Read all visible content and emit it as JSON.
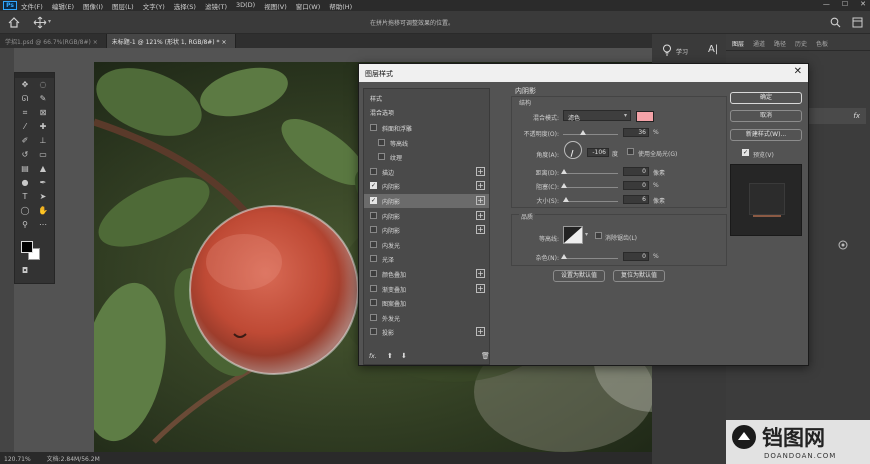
{
  "app": {
    "logo": "Ps"
  },
  "menu": [
    "文件(F)",
    "编辑(E)",
    "图像(I)",
    "图层(L)",
    "文字(Y)",
    "选择(S)",
    "滤镜(T)",
    "3D(D)",
    "视图(V)",
    "窗口(W)",
    "帮助(H)"
  ],
  "window_controls": {
    "min": "—",
    "max": "☐",
    "close": "✕"
  },
  "options_bar": {
    "hint": "在拼片拖移可调整效果的位置。"
  },
  "doc_tabs": [
    {
      "label": "学招1.psd @ 66.7%(RGB/8#) ×",
      "active": false
    },
    {
      "label": "未标题-1 @ 121% (形状 1, RGB/8#) * ×",
      "active": true
    }
  ],
  "status": {
    "zoom": "120.71%",
    "doc": "文档:2.84M/56.2M"
  },
  "right_panels": {
    "learn_label": "学习",
    "tabs": [
      "图层",
      "通道",
      "路径",
      "历史",
      "色板"
    ],
    "fx_label": "fx"
  },
  "dialog": {
    "title": "图层样式",
    "close": "✕",
    "styles_header": "样式",
    "blend_options": "混合选项",
    "styles": [
      {
        "label": "斜面和浮雕",
        "checked": false,
        "indent": false,
        "plus": false,
        "selected": false
      },
      {
        "label": "等高线",
        "checked": false,
        "indent": true,
        "plus": false,
        "selected": false
      },
      {
        "label": "纹理",
        "checked": false,
        "indent": true,
        "plus": false,
        "selected": false
      },
      {
        "label": "描边",
        "checked": false,
        "indent": false,
        "plus": true,
        "selected": false
      },
      {
        "label": "内阴影",
        "checked": true,
        "indent": false,
        "plus": true,
        "selected": false
      },
      {
        "label": "内阴影",
        "checked": true,
        "indent": false,
        "plus": true,
        "selected": true
      },
      {
        "label": "内阴影",
        "checked": false,
        "indent": false,
        "plus": true,
        "selected": false
      },
      {
        "label": "内阴影",
        "checked": false,
        "indent": false,
        "plus": true,
        "selected": false
      },
      {
        "label": "内发光",
        "checked": false,
        "indent": false,
        "plus": false,
        "selected": false
      },
      {
        "label": "光泽",
        "checked": false,
        "indent": false,
        "plus": false,
        "selected": false
      },
      {
        "label": "颜色叠加",
        "checked": false,
        "indent": false,
        "plus": true,
        "selected": false
      },
      {
        "label": "渐变叠加",
        "checked": false,
        "indent": false,
        "plus": true,
        "selected": false
      },
      {
        "label": "图案叠加",
        "checked": false,
        "indent": false,
        "plus": false,
        "selected": false
      },
      {
        "label": "外发光",
        "checked": false,
        "indent": false,
        "plus": false,
        "selected": false
      },
      {
        "label": "投影",
        "checked": false,
        "indent": false,
        "plus": true,
        "selected": false
      }
    ],
    "footer_icons": {
      "fx": "fx.",
      "up": "⬆",
      "down": "⬇",
      "trash": "🗑"
    },
    "section_title": "内阴影",
    "structure_title": "结构",
    "blend_mode_label": "混合模式:",
    "blend_mode_value": "滤色",
    "swatch_color": "#f4a3a8",
    "opacity_label": "不透明度(O):",
    "opacity_value": "36",
    "opacity_pct": 0.36,
    "opacity_unit": "%",
    "angle_label": "角度(A):",
    "angle_value": "-106",
    "angle_unit": "度",
    "global_light_label": "使用全局光(G)",
    "global_light_checked": false,
    "distance_label": "距离(D):",
    "distance_value": "0",
    "distance_unit": "像素",
    "choke_label": "阻塞(C):",
    "choke_value": "0",
    "choke_unit": "%",
    "size_label": "大小(S):",
    "size_value": "6",
    "size_unit": "像素",
    "quality_title": "品质",
    "contour_label": "等高线:",
    "antialias_label": "消除锯齿(L)",
    "noise_label": "杂色(N):",
    "noise_value": "0",
    "noise_unit": "%",
    "set_default_btn": "设置为默认值",
    "reset_default_btn": "复位为默认值",
    "ok_btn": "确定",
    "cancel_btn": "取消",
    "new_style_btn": "新建样式(W)...",
    "preview_label": "预览(V)",
    "preview_checked": true
  },
  "watermark": {
    "brand": "铛图网",
    "url": "DOANDOAN.COM"
  }
}
